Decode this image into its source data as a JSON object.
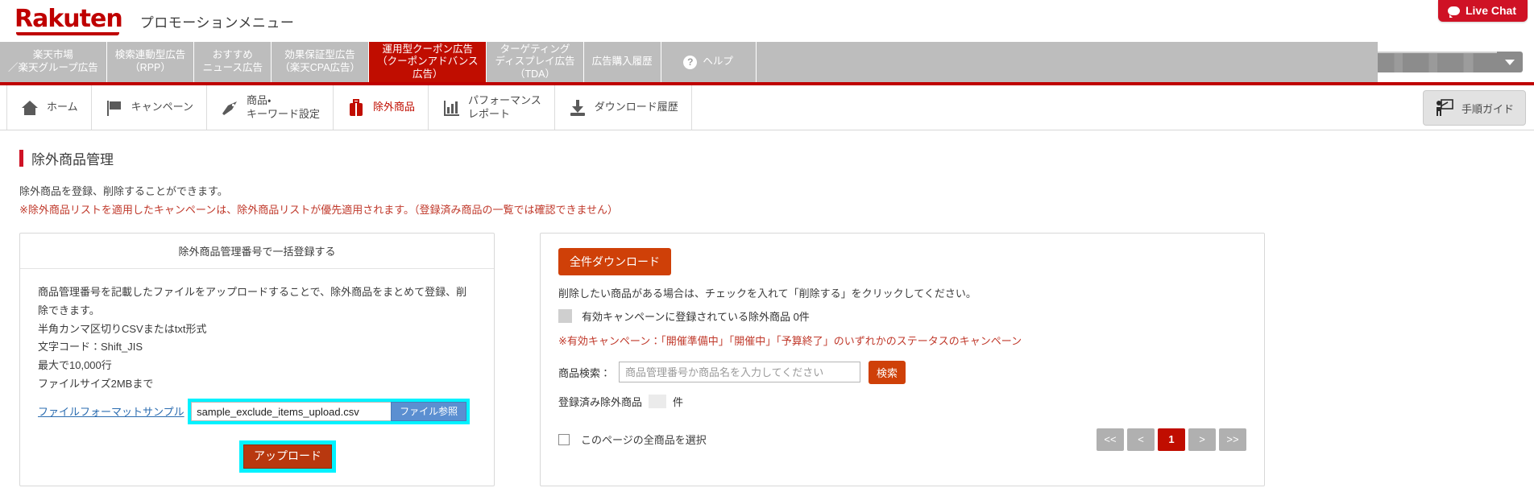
{
  "header": {
    "logo": "Rakuten",
    "title": "プロモーションメニュー",
    "live_chat": "Live Chat"
  },
  "tabs": [
    {
      "label": "楽天市場\n／楽天グループ広告",
      "active": false
    },
    {
      "label": "検索連動型広告\n（RPP）",
      "active": false
    },
    {
      "label": "おすすめ\nニュース広告",
      "active": false
    },
    {
      "label": "効果保証型広告\n（楽天CPA広告）",
      "active": false
    },
    {
      "label": "運用型クーポン広告\n（クーポンアドバンス\n広告）",
      "active": true
    },
    {
      "label": "ターゲティング\nディスプレイ広告\n（TDA）",
      "active": false
    },
    {
      "label": "広告購入履歴",
      "active": false
    },
    {
      "label": "ヘルプ",
      "active": false
    }
  ],
  "menu": [
    {
      "label": "ホーム",
      "icon": "home-icon",
      "selected": false
    },
    {
      "label": "キャンペーン",
      "icon": "flag-icon",
      "selected": false
    },
    {
      "label": "商品・\nキーワード設定",
      "icon": "tag-icon",
      "selected": false
    },
    {
      "label": "除外商品",
      "icon": "briefcase-icon",
      "selected": true
    },
    {
      "label": "パフォーマンス\nレポート",
      "icon": "bar-chart-icon",
      "selected": false
    },
    {
      "label": "ダウンロード履歴",
      "icon": "download-icon",
      "selected": false
    }
  ],
  "guide_button": {
    "label": "手順ガイド",
    "icon": "presenter-icon"
  },
  "page": {
    "title": "除外商品管理",
    "desc1": "除外商品を登録、削除することができます。",
    "desc2": "※除外商品リストを適用したキャンペーンは、除外商品リストが優先適用されます。（登録済み商品の一覧では確認できません）"
  },
  "left_panel": {
    "heading": "除外商品管理番号で一括登録する",
    "lines": [
      "商品管理番号を記載したファイルをアップロードすることで、除外商品をまとめて登録、削除できます。",
      "半角カンマ区切りCSVまたはtxt形式",
      "文字コード：Shift_JIS",
      "最大で10,000行",
      "ファイルサイズ2MBまで"
    ],
    "sample_link": "ファイルフォーマットサンプル",
    "file_value": "sample_exclude_items_upload.csv",
    "browse_label": "ファイル参照",
    "upload_label": "アップロード"
  },
  "right_panel": {
    "download_all": "全件ダウンロード",
    "delete_note": "削除したい商品がある場合は、チェックを入れて「削除する」をクリックしてください。",
    "active_campaign_items": "有効キャンペーンに登録されている除外商品 0件",
    "active_campaign_note": "※有効キャンペーン：「開催準備中」「開催中」「予算終了」のいずれかのステータスのキャンペーン",
    "search_label": "商品検索：",
    "search_placeholder": "商品管理番号か商品名を入力してください",
    "search_button": "検索",
    "registered_prefix": "登録済み除外商品",
    "registered_count": "",
    "registered_suffix": "件",
    "select_all_label": "このページの全商品を選択",
    "pager": [
      "<<",
      "<",
      "1",
      ">",
      ">>"
    ],
    "pager_current": "1"
  },
  "colors": {
    "brand_red": "#bf0000",
    "tab_active": "#c00d00",
    "accent_orange": "#cf4008",
    "highlight_cyan": "#00f2ff",
    "link_blue": "#2b6cb0",
    "warn_red": "#c0392b"
  }
}
